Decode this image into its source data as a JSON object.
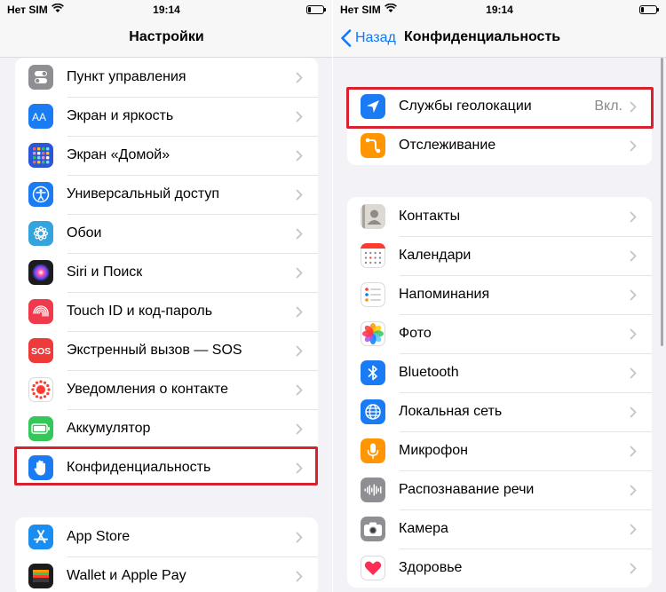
{
  "status": {
    "carrier": "Нет SIM",
    "time": "19:14"
  },
  "left": {
    "title": "Настройки",
    "group1": [
      {
        "label": "Пункт управления",
        "icon": "control-center-icon",
        "color": "#8e8e93"
      },
      {
        "label": "Экран и яркость",
        "icon": "display-brightness-icon",
        "color": "#1a7bf2"
      },
      {
        "label": "Экран «Домой»",
        "icon": "home-screen-icon",
        "color": "#2c56d8"
      },
      {
        "label": "Универсальный доступ",
        "icon": "accessibility-icon",
        "color": "#1a7bf2"
      },
      {
        "label": "Обои",
        "icon": "wallpaper-icon",
        "color": "#36a4dc"
      },
      {
        "label": "Siri и Поиск",
        "icon": "siri-icon",
        "color": "#1c1c1e"
      },
      {
        "label": "Touch ID и код-пароль",
        "icon": "touch-id-icon",
        "color": "#ef3a4c"
      },
      {
        "label": "Экстренный вызов — SOS",
        "icon": "sos-icon",
        "color": "#ef3a3a"
      },
      {
        "label": "Уведомления о контакте",
        "icon": "exposure-notification-icon",
        "color": "#ffffff"
      },
      {
        "label": "Аккумулятор",
        "icon": "battery-icon",
        "color": "#34c759"
      },
      {
        "label": "Конфиденциальность",
        "icon": "privacy-hand-icon",
        "color": "#1a7bf2"
      }
    ],
    "group2": [
      {
        "label": "App Store",
        "icon": "app-store-icon",
        "color": "#1a8df0"
      },
      {
        "label": "Wallet и Apple Pay",
        "icon": "wallet-icon",
        "color": "#1c1c1e"
      }
    ]
  },
  "right": {
    "back_label": "Назад",
    "title": "Конфиденциальность",
    "group1": [
      {
        "label": "Службы геолокации",
        "value": "Вкл.",
        "icon": "location-arrow-icon",
        "color": "#1a7bf2"
      },
      {
        "label": "Отслеживание",
        "value": "",
        "icon": "tracking-icon",
        "color": "#ff9500"
      }
    ],
    "group2": [
      {
        "label": "Контакты",
        "icon": "contacts-icon",
        "color": "#c7c7cc"
      },
      {
        "label": "Календари",
        "icon": "calendar-icon",
        "color": "#ffffff"
      },
      {
        "label": "Напоминания",
        "icon": "reminders-icon",
        "color": "#ffffff"
      },
      {
        "label": "Фото",
        "icon": "photos-icon",
        "color": "#ffffff"
      },
      {
        "label": "Bluetooth",
        "icon": "bluetooth-icon",
        "color": "#1a7bf2"
      },
      {
        "label": "Локальная сеть",
        "icon": "local-network-icon",
        "color": "#1a7bf2"
      },
      {
        "label": "Микрофон",
        "icon": "microphone-icon",
        "color": "#ff9500"
      },
      {
        "label": "Распознавание речи",
        "icon": "speech-recognition-icon",
        "color": "#8e8e93"
      },
      {
        "label": "Камера",
        "icon": "camera-icon",
        "color": "#8e8e93"
      },
      {
        "label": "Здоровье",
        "icon": "health-icon",
        "color": "#ffffff"
      }
    ]
  },
  "accent": "#0a7aff",
  "highlight_color": "#d8202f"
}
